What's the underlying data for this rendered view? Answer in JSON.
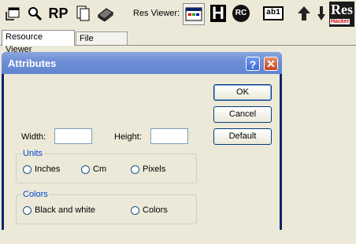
{
  "toolbar": {
    "res_viewer_label": "Res Viewer:",
    "logo_text_top": "Res",
    "logo_text_bottom": "Hacker",
    "h_letter": "H",
    "rc_text": "RC",
    "rp_text": "RP",
    "data_text": "ab1",
    "colors": {
      "logo_bg": "#1a1a1a",
      "logo_accent": "#cc0000"
    }
  },
  "tabs": [
    {
      "label": "Resource Viewer",
      "active": true
    },
    {
      "label": "File Browser",
      "active": false
    }
  ],
  "dialog": {
    "title": "Attributes",
    "help_glyph": "?",
    "close_glyph": "✕",
    "buttons": {
      "ok": "OK",
      "cancel": "Cancel",
      "default": "Default"
    },
    "width_label": "Width:",
    "width_value": "",
    "height_label": "Height:",
    "height_value": "",
    "units": {
      "title": "Units",
      "options": [
        "Inches",
        "Cm",
        "Pixels"
      ],
      "selected": null
    },
    "colors": {
      "title": "Colors",
      "options": [
        "Black and white",
        "Colors"
      ],
      "selected": null
    }
  }
}
